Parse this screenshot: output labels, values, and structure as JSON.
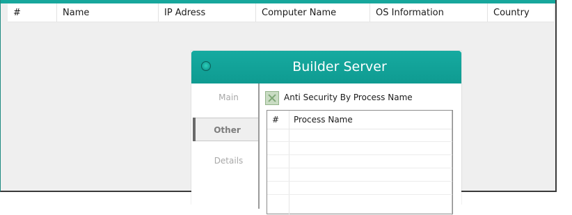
{
  "main": {
    "columns": [
      "#",
      "Name",
      "IP Adress",
      "Computer Name",
      "OS Information",
      "Country"
    ]
  },
  "dialog": {
    "title": "Builder Server",
    "sidebar": {
      "items": [
        "Main",
        "Other",
        "Details"
      ],
      "selected": "Other"
    },
    "option": {
      "label": "Anti Security By Process Name",
      "checked": true
    },
    "process_table": {
      "columns": [
        "#",
        "Process Name"
      ],
      "rows": []
    }
  },
  "colors": {
    "accent": "#17a79c",
    "background": "#efefef"
  }
}
